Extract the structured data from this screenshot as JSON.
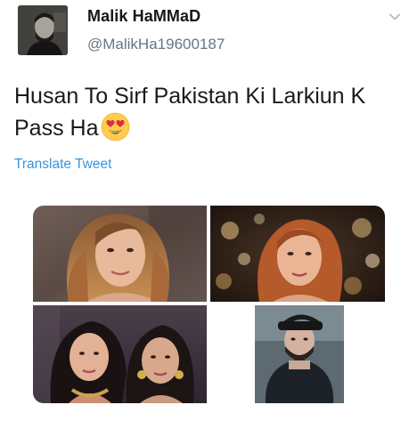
{
  "tweet": {
    "author_name": "Malik HaMMaD",
    "author_handle": "@MalikHa19600187",
    "text": "Husan To Sirf Pakistan Ki Larkiun K Pass Ha",
    "emoji": "heart-eyes-emoji",
    "translate_label": "Translate Tweet",
    "photos": [
      {
        "subject": "woman-with-long-auburn-hair"
      },
      {
        "subject": "woman-with-red-hair-bokeh-lights"
      },
      {
        "subject": "two-women-with-jewelry"
      },
      {
        "subject": "man-with-cap-selfie"
      }
    ]
  },
  "colors": {
    "handle": "#657786",
    "link": "#3b94d9",
    "text": "#14171a"
  },
  "icons": {
    "menu": "chevron-down-icon"
  }
}
